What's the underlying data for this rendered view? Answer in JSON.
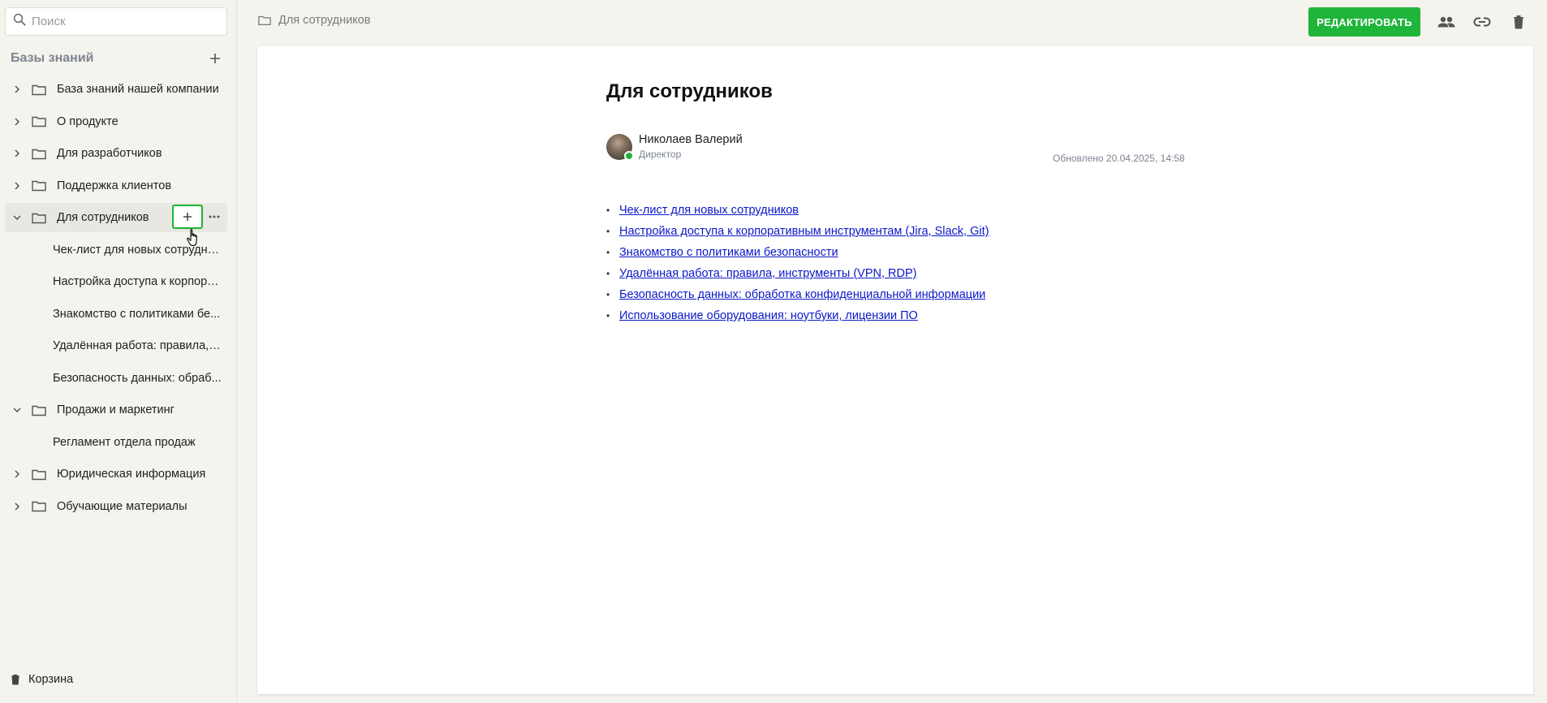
{
  "search": {
    "placeholder": "Поиск"
  },
  "sidebar": {
    "title": "Базы знаний",
    "items": [
      {
        "label": "База знаний нашей компании",
        "type": "folder",
        "expanded": false
      },
      {
        "label": "О продукте",
        "type": "folder",
        "expanded": false
      },
      {
        "label": "Для разработчиков",
        "type": "folder",
        "expanded": false
      },
      {
        "label": "Поддержка клиентов",
        "type": "folder",
        "expanded": false
      },
      {
        "label": "Для сотрудников",
        "type": "folder",
        "expanded": true,
        "active": true
      },
      {
        "label": "Чек-лист для новых сотрудни...",
        "type": "page"
      },
      {
        "label": "Настройка доступа к корпора...",
        "type": "page"
      },
      {
        "label": "Знакомство с политиками бе...",
        "type": "page"
      },
      {
        "label": "Удалённая работа: правила, ...",
        "type": "page"
      },
      {
        "label": "Безопасность данных: обраб...",
        "type": "page"
      },
      {
        "label": "Продажи и маркетинг",
        "type": "folder",
        "expanded": true
      },
      {
        "label": "Регламент отдела продаж",
        "type": "page"
      },
      {
        "label": "Юридическая информация",
        "type": "folder",
        "expanded": false
      },
      {
        "label": "Обучающие материалы",
        "type": "folder",
        "expanded": false
      }
    ],
    "trash_label": "Корзина"
  },
  "breadcrumb": {
    "label": "Для сотрудников"
  },
  "toolbar": {
    "edit_label": "РЕДАКТИРОВАТЬ",
    "icons": [
      "people-icon",
      "link-icon",
      "trash-icon"
    ]
  },
  "document": {
    "title": "Для сотрудников",
    "author": {
      "name": "Николаев Валерий",
      "role": "Директор",
      "online": true
    },
    "updated": "Обновлено 20.04.2025, 14:58",
    "links": [
      "Чек-лист для новых сотрудников",
      "Настройка доступа к корпоративным инструментам (Jira, Slack, Git)",
      "Знакомство с политиками безопасности",
      "Удалённая работа: правила, инструменты (VPN, RDP)",
      "Безопасность данных: обработка конфиденциальной информации",
      "Использование оборудования: ноутбуки, лицензии ПО"
    ]
  },
  "colors": {
    "accent": "#1fb53a",
    "link": "#0b18c8",
    "sidebar_bg": "#f4f3ee",
    "muted": "#7d8590"
  }
}
